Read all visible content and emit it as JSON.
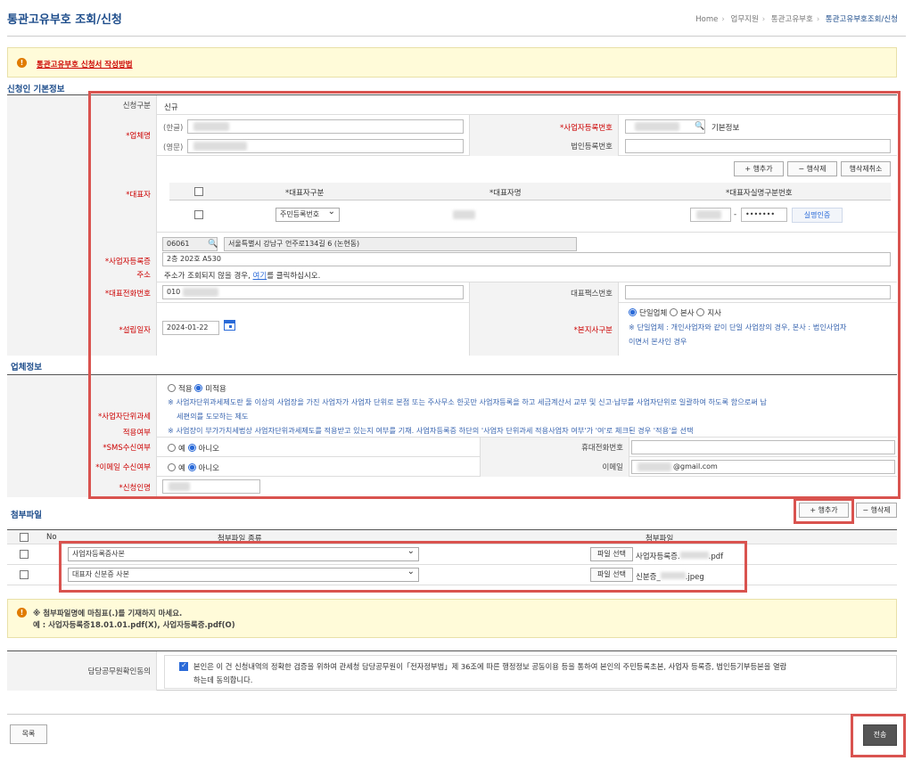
{
  "header": {
    "title": "통관고유부호 조회/신청",
    "breadcrumb": [
      "Home",
      "업무지원",
      "통관고유부호",
      "통관고유부호조회/신청"
    ]
  },
  "info_link": "통관고유부호 신청서 작성방법",
  "section_basic": "신청인 기본정보",
  "basic": {
    "apply_type_label": "신청구분",
    "apply_type_value": "신규",
    "company_label": "*업체명",
    "company_kr_prefix": "(한글)",
    "company_en_prefix": "(영문)",
    "bizno_label": "*사업자등록번호",
    "bizno_info": "기본정보",
    "corpno_label": "법인등록번호",
    "row_add": "+ 행추가",
    "row_del": "− 행삭제",
    "row_del_cancel": "행삭제취소",
    "rep_label": "*대표자",
    "rep_col_type": "*대표자구분",
    "rep_col_name": "*대표자명",
    "rep_col_id": "*대표자실명구분번호",
    "rep_type_value": "주민등록번호",
    "rep_id_mask": "•••••••",
    "rep_verify": "실명인증",
    "addr_label": "*사업자등록증 주소",
    "addr_zip": "06061",
    "addr_main": "서울특별시 강남구 언주로134길 6 (논현동)",
    "addr_detail": "2층 202호 A530",
    "addr_hint_pre": "주소가 조회되지 않을 경우,",
    "addr_hint_link": "여기",
    "addr_hint_post": "를 클릭하십시오.",
    "phone_label": "*대표전화번호",
    "phone_value": "010",
    "fax_label": "대표팩스번호",
    "found_label": "*설립일자",
    "found_value": "2024-01-22",
    "branch_label": "*본지사구분",
    "branch_opts": [
      "단일업체",
      "본사",
      "지사"
    ],
    "branch_note1": "※ 단일업체 : 개인사업자와 같이 단일 사업장의 경우, 본사 : 법인사업자",
    "branch_note2": "이면서 본사인 경우"
  },
  "section_company": "업체정보",
  "company": {
    "unit_label1": "*사업자단위과세",
    "unit_label2": "적용여부",
    "unit_opts": [
      "적용",
      "미적용"
    ],
    "unit_note1": "※ 사업자단위과세제도란 둘 이상의 사업장을 가진 사업자가 사업자 단위로 본점 또는 주사무소 한곳만 사업자등록을 하고 세금계산서 교부 및 신고·납부를 사업자단위로 일괄하여 하도록 함으로써 납",
    "unit_note2": "세편의를 도모하는 제도",
    "unit_note3": "※ 사업장이 부가가치세법상 사업자단위과세제도를 적용받고 있는지 여부를 기재. 사업자등록증 하단의 '사업자 단위과세 적용사업자 여부'가 '여'로 체크된 경우 '적용'을 선택",
    "sms_label": "*SMS수신여부",
    "yes": "예",
    "no": "아니오",
    "mobile_label": "휴대전화번호",
    "email_label": "*이메일 수신여부",
    "email_field_label": "이메일",
    "email_value": "@gmail.com",
    "applicant_label": "*신청인명"
  },
  "section_attach": "첨부파일",
  "attach": {
    "add": "+ 행추가",
    "del": "− 행삭제",
    "col_no": "No",
    "col_type": "첨부파일 종류",
    "col_file": "첨부파일",
    "pick": "파일 선택",
    "rows": [
      {
        "type": "사업자등록증사본",
        "file_pre": "사업자등록증.",
        "file_ext": ".pdf"
      },
      {
        "type": "대표자 신분증 사본",
        "file_pre": "신분증_",
        "file_ext": ".jpeg"
      }
    ]
  },
  "warn": {
    "line1": "※ 첨부파일명에 마침표(.)를 기재하지 마세요.",
    "line2": "예 : 사업자등록증18.01.01.pdf(X), 사업자등록증.pdf(O)"
  },
  "consent": {
    "label": "담당공무원확인동의",
    "text1": "본인은 이 건 신청내역의 정확한 검증을 위하여 관세청 담당공무원이「전자정부법」제 36조에 따른 행정정보 공동이용 등을 통하여 본인의 주민등록초본, 사업자 등록증, 법인등기부등본을 열람",
    "text2": "하는데 동의합니다."
  },
  "footer": {
    "list": "목록",
    "submit": "전송"
  }
}
